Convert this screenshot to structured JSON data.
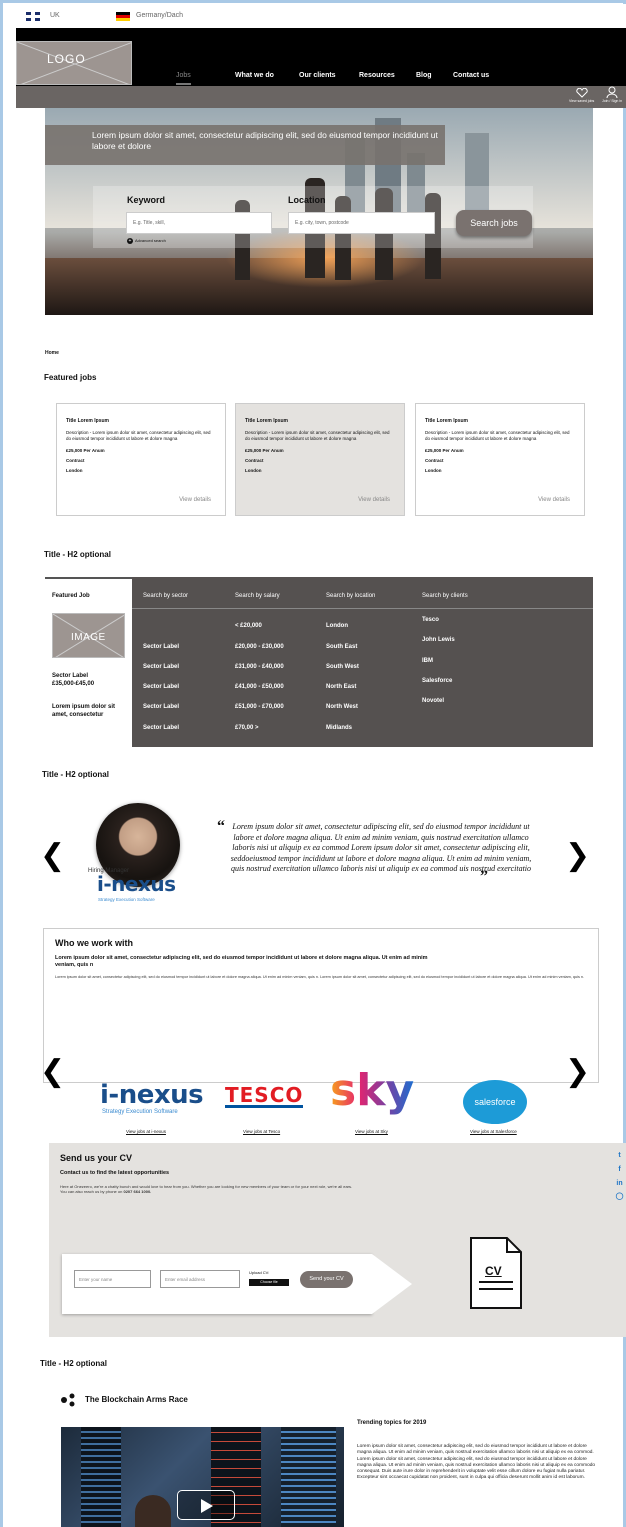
{
  "langbar": {
    "uk": "UK",
    "germany": "Germany/Dach"
  },
  "header": {
    "logo": "LOGO",
    "nav": [
      "Jobs",
      "What we do",
      "Our clients",
      "Resources",
      "Blog",
      "Contact us"
    ],
    "saved_jobs": "View saved jobs",
    "join": "Join / Sign in"
  },
  "hero": {
    "title": "Lorem ipsum dolor sit amet, consectetur adipiscing elit, sed do eiusmod tempor incididunt ut labore et dolore",
    "keyword_label": "Keyword",
    "keyword_placeholder": "E.g. Title, skill,",
    "location_label": "Location",
    "location_placeholder": "E.g. city, town, postcode",
    "search_button": "Search jobs",
    "advanced": "Advanced search"
  },
  "breadcrumb": "Home",
  "featured": {
    "heading": "Featured jobs",
    "cards": [
      {
        "title": "Title Lorem Ipsum",
        "desc": "Description - Lorem ipsum dolor sit amet, consectetur adipiscing elit, sed do eiusmod tempor incididunt ut labore et dolore magna",
        "salary": "£25,000 Per Anum",
        "type": "Contract",
        "location": "London",
        "link": "View details"
      },
      {
        "title": "Title Lorem Ipsum",
        "desc": "Description - Lorem ipsum dolor sit amet, consectetur adipiscing elit, sed do eiusmod tempor incididunt ut labore et dolore magna",
        "salary": "£25,000 Per Anum",
        "type": "Contract",
        "location": "London",
        "link": "View details"
      },
      {
        "title": "Title Lorem Ipsum",
        "desc": "Description - Lorem ipsum dolor sit amet, consectetur adipiscing elit, sed do eiusmod tempor incididunt ut labore et dolore magna",
        "salary": "£25,000 Per Anum",
        "type": "Contract",
        "location": "London",
        "link": "View details"
      }
    ]
  },
  "section2": {
    "heading": "Title - H2 optional",
    "featured_job": "Featured Job",
    "image": "IMAGE",
    "sector": "Sector Label",
    "range": "£35,000-£45,00",
    "lorem": "Lorem ipsum dolor sit amet, consectetur",
    "cols": [
      "Search by sector",
      "Search by salary",
      "Search by location",
      "Search by clients"
    ],
    "sectors": [
      "Sector Label",
      "Sector Label",
      "Sector Label",
      "Sector Label",
      "Sector Label"
    ],
    "salaries": [
      "< £20,000",
      "£20,000 - £30,000",
      "£31,000 - £40,000",
      "£41,000 - £50,000",
      "£51,000 - £70,000",
      "£70,00 >"
    ],
    "locations": [
      "London",
      "South East",
      "South West",
      "North East",
      "North West",
      "Midlands"
    ],
    "clients": [
      "Tesco",
      "John Lewis",
      "IBM",
      "Salesforce",
      "Novotel"
    ]
  },
  "section3": {
    "heading": "Title - H2 optional",
    "role": "Hiring Manager",
    "brand": "i-nexus",
    "brand_sub": "Strategy Execution Software",
    "quote": "Lorem ipsum dolor sit amet, consectetur adipiscing elit, sed do eiusmod tempor incididunt ut labore et dolore magna aliqua. Ut enim ad minim veniam, quis nostrud exercitation ullamco laboris nisi ut aliquip ex ea commod  Lorem ipsum dolor sit amet, consectetur adipiscing elit, seddoeiusmod tempor incididunt ut labore et dolore magna aliqua. Ut enim ad minim veniam, quis nostrud exercitation ullamco laboris nisi ut aliquip ex ea commod uis nostrud exercitatio"
  },
  "who": {
    "heading": "Who we work with",
    "sub": "Lorem ipsum dolor sit amet, consectetur adipiscing elit, sed do eiusmod tempor incididunt ut labore et dolore magna aliqua. Ut enim ad minim veniam, quis n",
    "body": "Lorem ipsum dolor sit amet, consectetur adipiscing elit, sed do eiusmod tempor incididunt ut labore et dolore magna aliqua. Ut enim ad minim veniam, quis n. Lorem ipsum dolor sit amet, consectetur adipiscing elit, sed do eiusmod tempor incididunt ut labore et dolore magna aliqua. Ut enim ad minim veniam, quis n.",
    "logos": {
      "inexus": "i-nexus",
      "inexus_sub": "Strategy Execution Software",
      "tesco": "TESCO",
      "sky": "sky",
      "salesforce": "salesforce"
    },
    "links": [
      "View jobs at i-nexus",
      "View jobs at Tesco",
      "View jobs at Sky",
      "View jobs at Salesforce"
    ]
  },
  "cv": {
    "heading": "Send us your CV",
    "sub": "Contact us to find the latest opportunities",
    "p1": "Here at Onezeero, we're a chatty bunch and would love to hear from you. Whether you are looking for new members of your team or for your next role, we're all ears.",
    "p2_prefix": "You can also reach us by phone on ",
    "phone": "0207 664 1000.",
    "name_ph": "Enter your name",
    "email_ph": "Enter email address",
    "upload": "Upload CV:",
    "choose": "Choose file",
    "send": "Send your CV",
    "icon": "CV"
  },
  "social": [
    "twitter-icon",
    "facebook-icon",
    "linkedin-icon",
    "instagram-icon"
  ],
  "blog": {
    "heading": "Title - H2 optional",
    "title": "The Blockchain Arms Race",
    "trending": "Trending topics for 2019",
    "text": "Lorem ipsum dolor sit amet, consectetur adipiscing elit, sed do eiusmod tempor incididunt ut labore et dolore magna aliqua. Ut enim ad minim veniam, quis nostrud exercitation ullamco laboris nisi ut aliquip ex ea commod. Lorem ipsum dolor sit amet, consectetur adipiscing elit, sed do eiusmod tempor incididunt ut labore et dolore magna aliqua. Ut enim ad minim veniam, quis nostrud exercitation ullamco laboris nisi ut aliquip ex ea commodo consequat. Duis aute irure dolor in reprehenderit in voluptate velit esse cillum dolore eu fugiat nulla pariatur. Excepteur sint occaecat cupidatat non proident, sunt in culpa qui officia deserunt mollit anim id est laborum."
  }
}
